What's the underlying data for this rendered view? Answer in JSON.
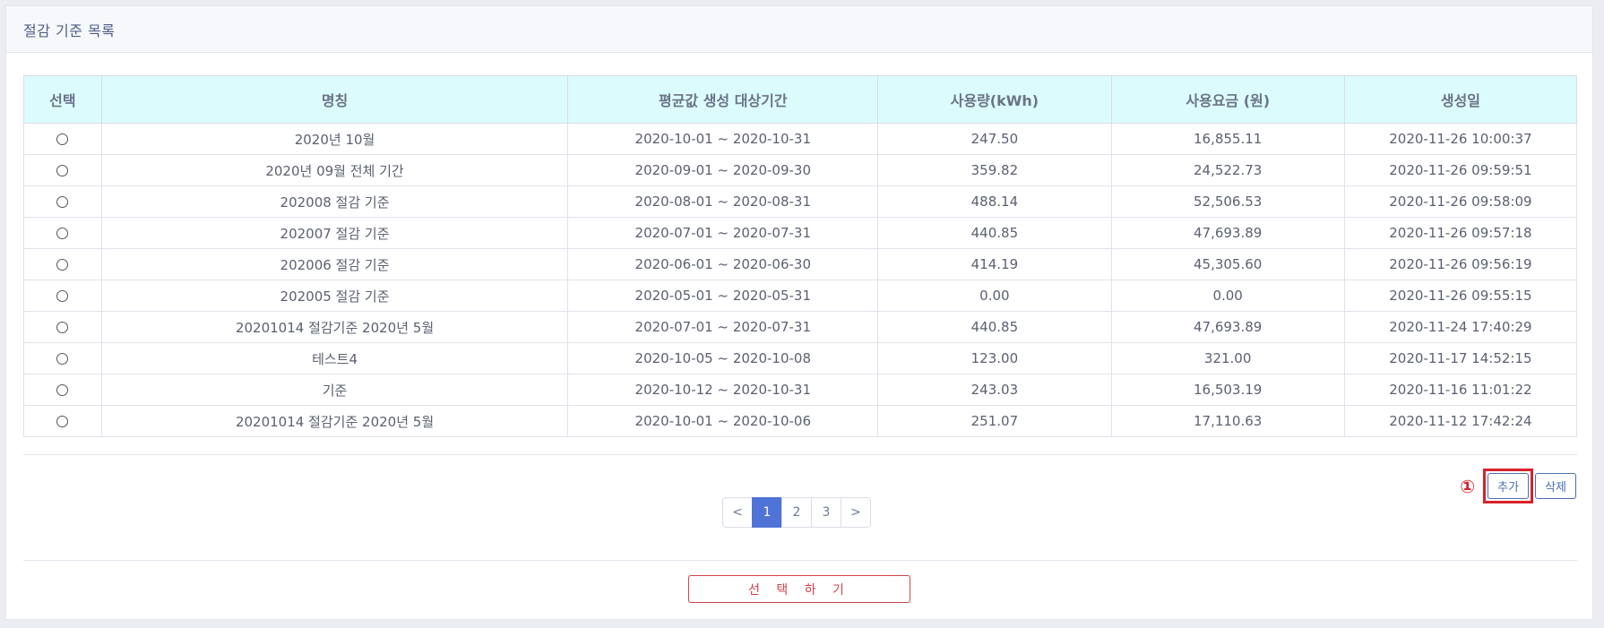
{
  "panel": {
    "title": "절감 기준 목록"
  },
  "table": {
    "headers": [
      "선택",
      "명칭",
      "평균값 생성 대상기간",
      "사용량(kWh)",
      "사용요금 (원)",
      "생성일"
    ],
    "rows": [
      {
        "name": "2020년 10월",
        "period": "2020-10-01 ~ 2020-10-31",
        "usage": "247.50",
        "fee": "16,855.11",
        "created": "2020-11-26 10:00:37"
      },
      {
        "name": "2020년 09월 전체 기간",
        "period": "2020-09-01 ~ 2020-09-30",
        "usage": "359.82",
        "fee": "24,522.73",
        "created": "2020-11-26 09:59:51"
      },
      {
        "name": "202008 절감 기준",
        "period": "2020-08-01 ~ 2020-08-31",
        "usage": "488.14",
        "fee": "52,506.53",
        "created": "2020-11-26 09:58:09"
      },
      {
        "name": "202007 절감 기준",
        "period": "2020-07-01 ~ 2020-07-31",
        "usage": "440.85",
        "fee": "47,693.89",
        "created": "2020-11-26 09:57:18"
      },
      {
        "name": "202006 절감 기준",
        "period": "2020-06-01 ~ 2020-06-30",
        "usage": "414.19",
        "fee": "45,305.60",
        "created": "2020-11-26 09:56:19"
      },
      {
        "name": "202005 절감 기준",
        "period": "2020-05-01 ~ 2020-05-31",
        "usage": "0.00",
        "fee": "0.00",
        "created": "2020-11-26 09:55:15"
      },
      {
        "name": "20201014 절감기준 2020년 5월",
        "period": "2020-07-01 ~ 2020-07-31",
        "usage": "440.85",
        "fee": "47,693.89",
        "created": "2020-11-24 17:40:29"
      },
      {
        "name": "테스트4",
        "period": "2020-10-05 ~ 2020-10-08",
        "usage": "123.00",
        "fee": "321.00",
        "created": "2020-11-17 14:52:15"
      },
      {
        "name": "기준",
        "period": "2020-10-12 ~ 2020-10-31",
        "usage": "243.03",
        "fee": "16,503.19",
        "created": "2020-11-16 11:01:22"
      },
      {
        "name": "20201014 절감기준 2020년 5월",
        "period": "2020-10-01 ~ 2020-10-06",
        "usage": "251.07",
        "fee": "17,110.63",
        "created": "2020-11-12 17:42:24"
      }
    ]
  },
  "actions": {
    "annotation": "①",
    "add_label": "추가",
    "delete_label": "삭제"
  },
  "pagination": {
    "prev": "<",
    "next": ">",
    "pages": [
      "1",
      "2",
      "3"
    ],
    "current": "1"
  },
  "select_button": {
    "label": "선 택 하 기"
  },
  "colors": {
    "header_bg": "#dcfbfd",
    "accent": "#4f73d7",
    "annotation": "#d8222b"
  }
}
